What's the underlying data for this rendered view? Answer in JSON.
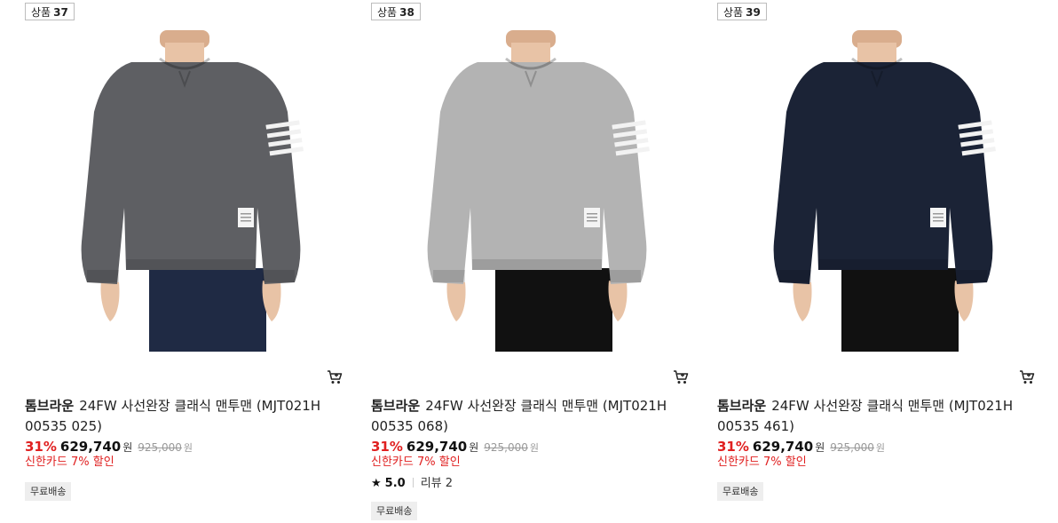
{
  "products": [
    {
      "badge_label": "상품",
      "badge_number": "37",
      "brand": "톰브라운",
      "name": "24FW 사선완장 클래식 맨투맨 (MJT021H 00535 025)",
      "discount": "31%",
      "price": "629,740",
      "currency": "원",
      "original_price": "925,000",
      "original_currency": "원",
      "card_discount": "신한카드 7% 할인",
      "shipping_tag": "무료배송",
      "sweater_color": "#5e5f63",
      "pants_color": "#1f2a44"
    },
    {
      "badge_label": "상품",
      "badge_number": "38",
      "brand": "톰브라운",
      "name": "24FW 사선완장 클래식 맨투맨 (MJT021H 00535 068)",
      "discount": "31%",
      "price": "629,740",
      "currency": "원",
      "original_price": "925,000",
      "original_currency": "원",
      "card_discount": "신한카드 7% 할인",
      "rating_icon": "star-icon",
      "rating": "5.0",
      "review_label": "리뷰",
      "review_count": "2",
      "shipping_tag": "무료배송",
      "sweater_color": "#b3b3b3",
      "pants_color": "#111111"
    },
    {
      "badge_label": "상품",
      "badge_number": "39",
      "brand": "톰브라운",
      "name": "24FW 사선완장 클래식 맨투맨 (MJT021H 00535 461)",
      "discount": "31%",
      "price": "629,740",
      "currency": "원",
      "original_price": "925,000",
      "original_currency": "원",
      "card_discount": "신한카드 7% 할인",
      "shipping_tag": "무료배송",
      "sweater_color": "#1b2336",
      "pants_color": "#111111"
    }
  ],
  "icons": {
    "cart": "shopping-cart-icon",
    "star": "star-icon"
  },
  "colors": {
    "discount_red": "#e02020",
    "tag_background": "#eeeeee"
  }
}
